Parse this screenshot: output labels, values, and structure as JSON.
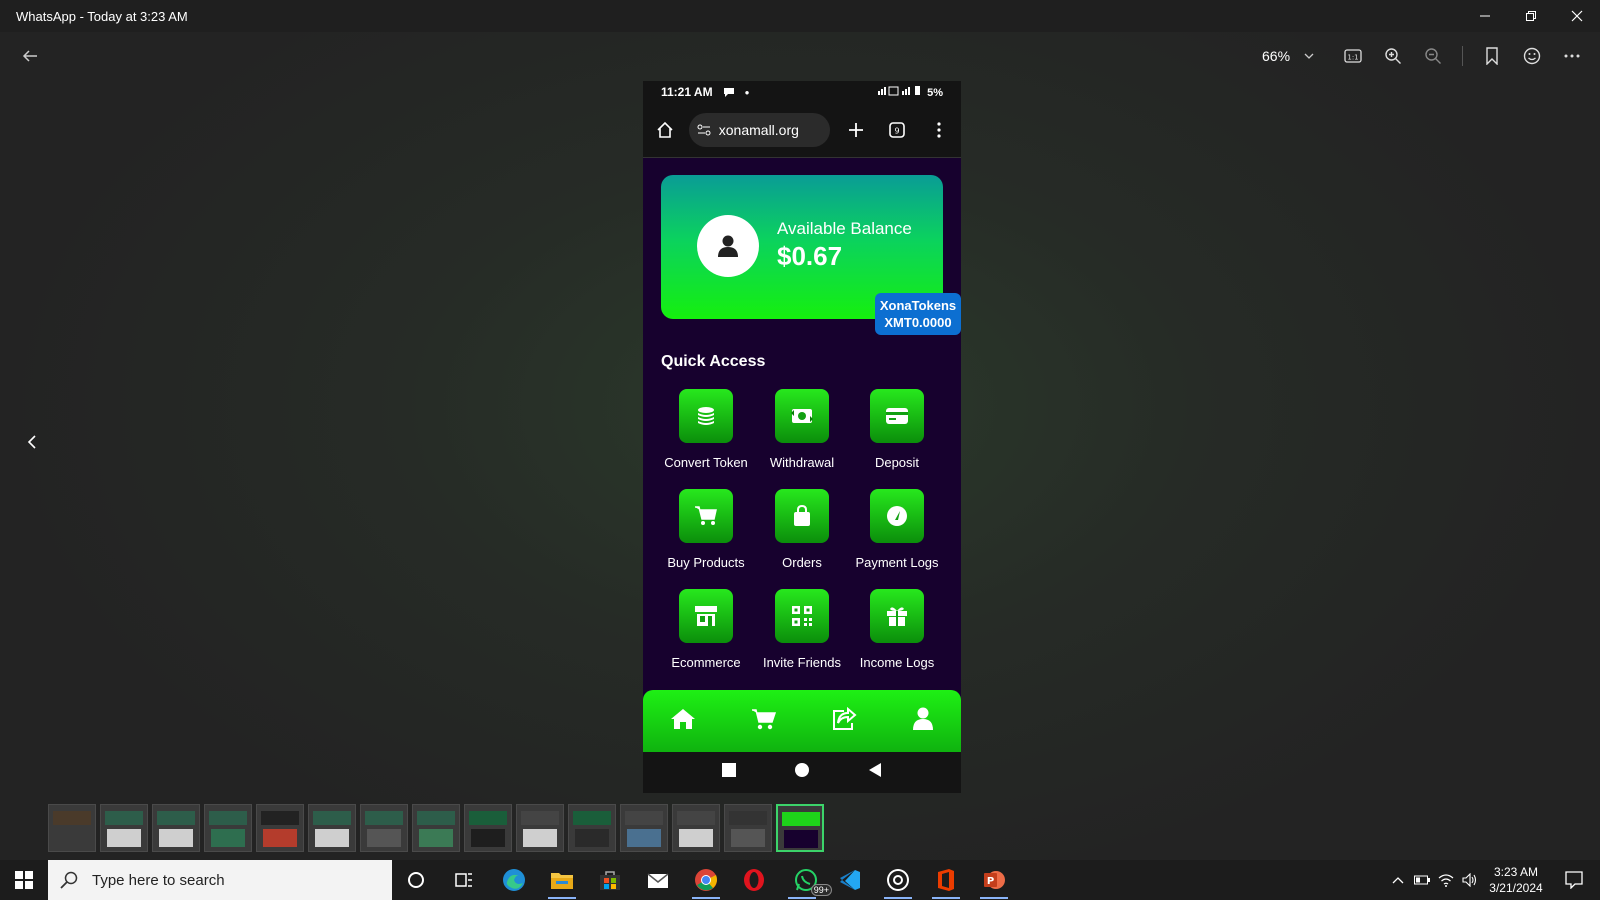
{
  "window": {
    "title": "WhatsApp - Today at 3:23 AM",
    "controls": [
      "minimize-icon",
      "restore-icon",
      "close-icon"
    ]
  },
  "viewer_toolbar": {
    "zoom_level": "66%",
    "icons": [
      "back-arrow-icon",
      "zoom-dropdown-icon",
      "actual-size-icon",
      "zoom-in-icon",
      "zoom-out-icon",
      "bookmark-icon",
      "emoji-icon",
      "more-icon"
    ]
  },
  "phone": {
    "status_bar": {
      "time": "11:21 AM",
      "battery": "5%"
    },
    "browser": {
      "url": "xonamall.org"
    },
    "balance_card": {
      "label": "Available Balance",
      "value": "$0.67",
      "tokens_name": "XonaTokens",
      "tokens_value": "XMT0.0000"
    },
    "quick_access": {
      "title": "Quick Access",
      "items": [
        {
          "label": "Convert Token",
          "icon": "coins-icon"
        },
        {
          "label": "Withdrawal",
          "icon": "cash-exchange-icon"
        },
        {
          "label": "Deposit",
          "icon": "credit-card-icon"
        },
        {
          "label": "Buy Products",
          "icon": "cart-icon"
        },
        {
          "label": "Orders",
          "icon": "shopping-bag-icon"
        },
        {
          "label": "Payment Logs",
          "icon": "gauge-icon"
        },
        {
          "label": "Ecommerce",
          "icon": "store-icon"
        },
        {
          "label": "Invite Friends",
          "icon": "qr-code-icon"
        },
        {
          "label": "Income Logs",
          "icon": "gift-icon"
        }
      ]
    },
    "bottom_nav": [
      "home-icon",
      "cart-icon",
      "share-icon",
      "user-icon"
    ]
  },
  "filmstrip": {
    "thumbnail_count": 15,
    "selected_index": 14
  },
  "taskbar": {
    "search_placeholder": "Type here to search",
    "whatsapp_badge": "99+",
    "time": "3:23 AM",
    "date": "3/21/2024"
  },
  "colors": {
    "accent_green": "#15f00e",
    "card_teal": "#0a9c96",
    "phone_bg": "#17012e",
    "token_badge_blue": "#0c6fd1"
  }
}
